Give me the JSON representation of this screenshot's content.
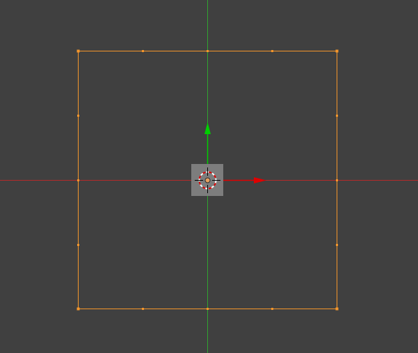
{
  "viewport": {
    "background": "#404040",
    "view": "top-orthographic"
  },
  "axes": {
    "x_axis_color": "#b42a2a",
    "y_axis_color": "#2fa52f"
  },
  "selected_object": {
    "type": "plane",
    "edit_mode": true,
    "selected": true,
    "edge_color": "#f5962b",
    "vertex_color": "#f5962b"
  },
  "transform_manipulator": {
    "x_arrow_color": "#e00000",
    "y_arrow_color": "#00d000",
    "pivot_color": "#e8a060",
    "background": "#7d7d7d"
  },
  "cursor_3d": {
    "ring_color_a": "#ffffff",
    "ring_color_b": "#e00000",
    "crosshair_color": "#000000"
  }
}
